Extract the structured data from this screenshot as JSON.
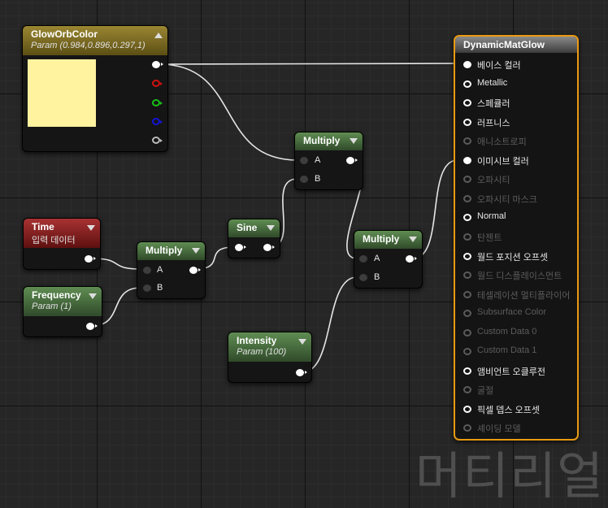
{
  "colors": {
    "accent": "#E99A12",
    "glow_swatch": "#FBE54B",
    "wire": "#E6E6E6"
  },
  "nodes": {
    "glow_orb": {
      "title": "GlowOrbColor",
      "subtitle": "Param (0.984,0.896,0.297,1)"
    },
    "time": {
      "title": "Time",
      "subtitle": "입력 데이터"
    },
    "frequency": {
      "title": "Frequency",
      "subtitle": "Param (1)"
    },
    "multiply_1": {
      "title": "Multiply",
      "input_a": "A",
      "input_b": "B"
    },
    "sine": {
      "title": "Sine"
    },
    "multiply_2": {
      "title": "Multiply",
      "input_a": "A",
      "input_b": "B"
    },
    "multiply_3": {
      "title": "Multiply",
      "input_a": "A",
      "input_b": "B"
    },
    "intensity": {
      "title": "Intensity",
      "subtitle": "Param (100)"
    }
  },
  "material": {
    "title": "DynamicMatGlow",
    "pins": [
      {
        "label": "베이스 컬러",
        "active": true,
        "connected": true
      },
      {
        "label": "Metallic",
        "active": true,
        "connected": false
      },
      {
        "label": "스페큘러",
        "active": true,
        "connected": false
      },
      {
        "label": "러프니스",
        "active": true,
        "connected": false
      },
      {
        "label": "애니소트로피",
        "active": false,
        "connected": false
      },
      {
        "label": "이미시브 컬러",
        "active": true,
        "connected": true
      },
      {
        "label": "오파시티",
        "active": false,
        "connected": false
      },
      {
        "label": "오파시티 마스크",
        "active": false,
        "connected": false
      },
      {
        "label": "Normal",
        "active": true,
        "connected": false
      },
      {
        "label": "탄젠트",
        "active": false,
        "connected": false
      },
      {
        "label": "월드 포지션 오프셋",
        "active": true,
        "connected": false
      },
      {
        "label": "월드 디스플레이스먼트",
        "active": false,
        "connected": false
      },
      {
        "label": "테셀레이션 멀티플라이어",
        "active": false,
        "connected": false
      },
      {
        "label": "Subsurface Color",
        "active": false,
        "connected": false
      },
      {
        "label": "Custom Data 0",
        "active": false,
        "connected": false
      },
      {
        "label": "Custom Data 1",
        "active": false,
        "connected": false
      },
      {
        "label": "앰비언트 오클루전",
        "active": true,
        "connected": false
      },
      {
        "label": "굴절",
        "active": false,
        "connected": false
      },
      {
        "label": "픽셀 뎁스 오프셋",
        "active": true,
        "connected": false
      },
      {
        "label": "셰이딩 모델",
        "active": false,
        "connected": false
      }
    ]
  },
  "watermark": "머티리얼"
}
